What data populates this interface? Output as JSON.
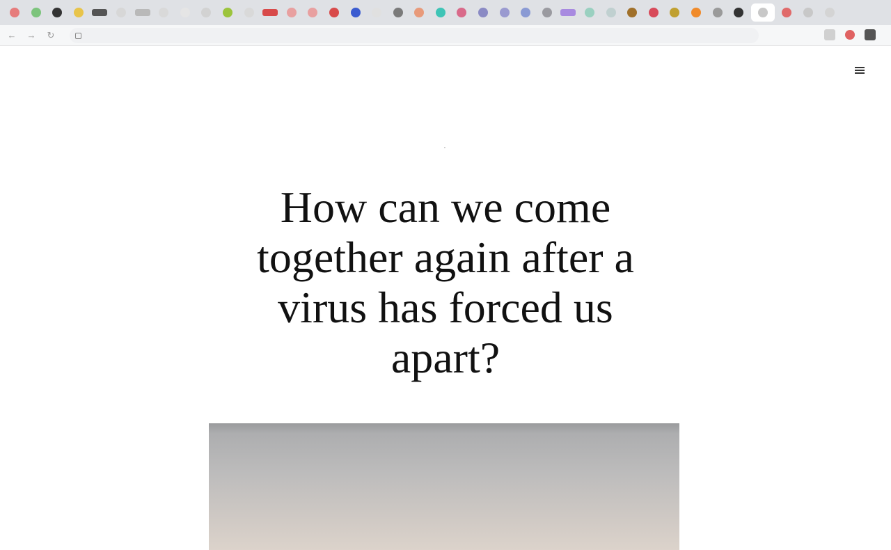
{
  "browser": {
    "tabs": [
      {
        "color": "#e67c7c"
      },
      {
        "color": "#7cc47c"
      },
      {
        "color": "#333333"
      },
      {
        "color": "#e8c44a"
      },
      {
        "color": "#555555",
        "wide": true
      },
      {
        "color": "#d7d7d7"
      },
      {
        "color": "#b9b9b9",
        "wide": true
      },
      {
        "color": "#d9d9d9"
      },
      {
        "color": "#e5e5e5"
      },
      {
        "color": "#d2d2d2"
      },
      {
        "color": "#9cc43c"
      },
      {
        "color": "#d9d9d9"
      },
      {
        "color": "#d84a4a",
        "wide": true
      },
      {
        "color": "#e8a0a0"
      },
      {
        "color": "#e8a0a0"
      },
      {
        "color": "#d84a4a"
      },
      {
        "color": "#3a5bd0"
      },
      {
        "color": "#e0e0e0"
      },
      {
        "color": "#7a7a7a"
      },
      {
        "color": "#e89a7a"
      },
      {
        "color": "#3ec4b6"
      },
      {
        "color": "#d96a8a"
      },
      {
        "color": "#8a8ac4"
      },
      {
        "color": "#9a9ad0"
      },
      {
        "color": "#8a9ad4"
      },
      {
        "color": "#9a9aa0"
      },
      {
        "color": "#a88ae0",
        "wide": true
      },
      {
        "color": "#9ad0c0"
      },
      {
        "color": "#c0d0d0"
      },
      {
        "color": "#a0702a"
      },
      {
        "color": "#d84a5a"
      },
      {
        "color": "#c0a030"
      },
      {
        "color": "#f08a2a"
      },
      {
        "color": "#9a9a9a"
      },
      {
        "color": "#333333"
      },
      {
        "color": "#ffffff",
        "active": true
      },
      {
        "color": "#e06a6a"
      },
      {
        "color": "#c8c8c8"
      },
      {
        "color": "#d4d4d4"
      }
    ],
    "url": ""
  },
  "site": {
    "logo": "",
    "menu_label": ""
  },
  "article": {
    "kicker_parts": [
      "",
      ""
    ],
    "headline": "How can we come together again after a virus has forced us apart?",
    "byline_name": "",
    "byline_role": "",
    "readtime_label": "",
    "readtime_value": ""
  }
}
